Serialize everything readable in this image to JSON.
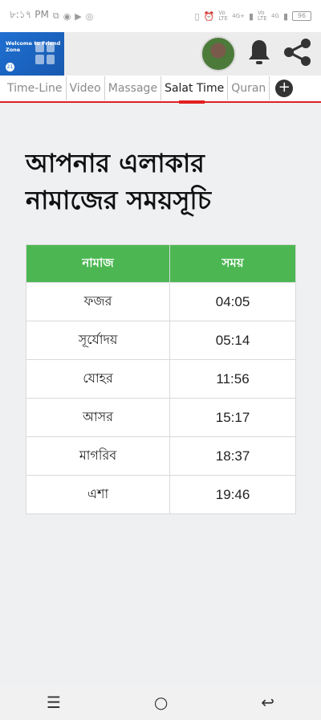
{
  "status_bar": {
    "time": "৮:১৭ PM",
    "left_icons": [
      "cast-icon",
      "messenger-icon",
      "youtube-icon",
      "instagram-icon"
    ],
    "right_icons": [
      "vibrate-icon",
      "alarm-icon",
      "wifi-icon",
      "signal-icon",
      "signal-icon"
    ],
    "network_1": "Vo LTE",
    "network_2": "4G+",
    "network_3": "Vo LTE",
    "network_4": "4G",
    "battery": "96"
  },
  "header": {
    "logo_title": "Welcome to Friend Zone",
    "logo_badge": "21"
  },
  "tabs": [
    {
      "label": "Time-Line"
    },
    {
      "label": "Video"
    },
    {
      "label": "Massage"
    },
    {
      "label": "Salat Time"
    },
    {
      "label": "Quran"
    }
  ],
  "page": {
    "title": "আপনার এলাকার নামাজের সময়সূচি"
  },
  "table": {
    "headers": [
      "নামাজ",
      "সময়"
    ],
    "rows": [
      {
        "name": "ফজর",
        "time": "04:05"
      },
      {
        "name": "সূর্যোদয়",
        "time": "05:14"
      },
      {
        "name": "যোহর",
        "time": "11:56"
      },
      {
        "name": "আসর",
        "time": "15:17"
      },
      {
        "name": "মাগরিব",
        "time": "18:37"
      },
      {
        "name": "এশা",
        "time": "19:46"
      }
    ]
  },
  "colors": {
    "accent": "#e02020",
    "table_header": "#4cb752"
  }
}
